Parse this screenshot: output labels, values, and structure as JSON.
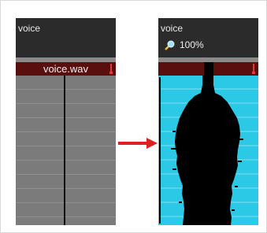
{
  "colors": {
    "header_bg": "#2b2b2b",
    "clip_bar": "#5a0f0f",
    "grey_track": "#7b7b7b",
    "cyan_track": "#2bc9e6",
    "arrow": "#e02020",
    "waveform": "#000000"
  },
  "left_panel": {
    "title": "voice",
    "clip_name": "voice.wav"
  },
  "right_panel": {
    "title": "voice",
    "zoom": "100%",
    "zoom_icon": "magnifier-icon"
  },
  "transition_icon": "arrow-right-icon"
}
